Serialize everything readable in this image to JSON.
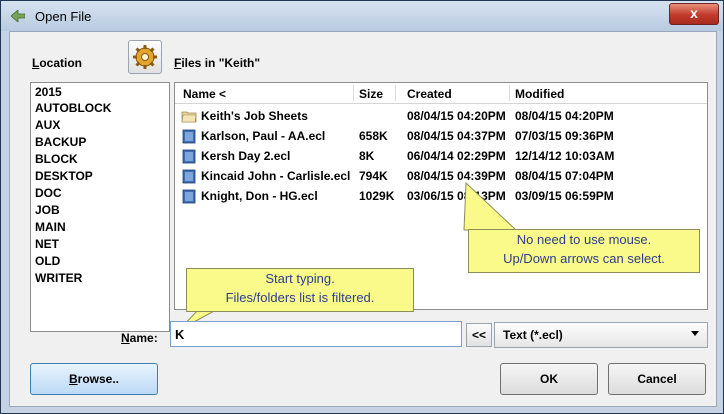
{
  "window": {
    "title": "Open File",
    "close_glyph": "x"
  },
  "location": {
    "label_u": "L",
    "label_rest": "ocation",
    "items": [
      "2015",
      "AUTOBLOCK",
      "AUX",
      "BACKUP",
      "BLOCK",
      "DESKTOP",
      "DOC",
      "JOB",
      "MAIN",
      "NET",
      "OLD",
      "WRITER"
    ]
  },
  "files": {
    "label_u": "F",
    "label_rest": "iles  in \"Keith\"",
    "columns": [
      "Name <",
      "Size",
      "Created",
      "Modified"
    ],
    "rows": [
      {
        "icon": "folder-icon",
        "name": "Keith's Job Sheets",
        "size": "",
        "created": "08/04/15 04:20PM",
        "modified": "08/04/15 04:20PM"
      },
      {
        "icon": "book-icon",
        "name": "Karlson, Paul - AA.ecl",
        "size": "658K",
        "created": "08/04/15 04:37PM",
        "modified": "07/03/15 09:36PM"
      },
      {
        "icon": "book-icon",
        "name": "Kersh Day 2.ecl",
        "size": "8K",
        "created": "06/04/14 02:29PM",
        "modified": "12/14/12 10:03AM"
      },
      {
        "icon": "book-icon",
        "name": "Kincaid John - Carlisle.ecl",
        "size": "794K",
        "created": "08/04/15 04:39PM",
        "modified": "08/04/15 07:04PM"
      },
      {
        "icon": "book-icon",
        "name": "Knight, Don - HG.ecl",
        "size": "1029K",
        "created": "03/06/15 08:13PM",
        "modified": "03/09/15 06:59PM"
      }
    ]
  },
  "callouts": {
    "mouse": [
      "No need to use mouse.",
      "Up/Down arrows can select."
    ],
    "typing": [
      "Start typing.",
      "Files/folders list is filtered."
    ]
  },
  "name_field": {
    "label_u": "N",
    "label_rest": "ame:",
    "value": "K"
  },
  "back_button": "<<",
  "file_type": {
    "selected": "Text (*.ecl)"
  },
  "buttons": {
    "browse_u": "B",
    "browse_rest": "rowse..",
    "ok": "OK",
    "cancel": "Cancel"
  },
  "colors": {
    "callout_bg": "#fafa8a",
    "callout_text": "#2c3e8c",
    "close_red": "#c0392b",
    "browse_blue": "#bcdaf6"
  }
}
